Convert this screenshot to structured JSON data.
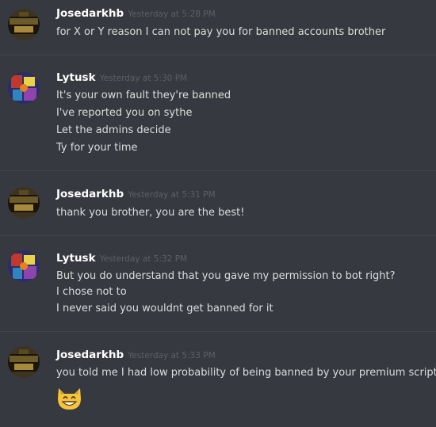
{
  "messages": [
    {
      "author": "Josedarkhb",
      "timestamp": "Yesterday at 5:28 PM",
      "avatar": "josedarkhb-avatar",
      "lines": [
        "for X or Y reason I can not pay you for banned accounts brother"
      ]
    },
    {
      "author": "Lytusk",
      "timestamp": "Yesterday at 5:30 PM",
      "avatar": "lytusk-avatar",
      "lines": [
        "It's your own fault they're banned",
        "I've reported you on sythe",
        "Let the admins decide",
        "Ty for your time"
      ]
    },
    {
      "author": "Josedarkhb",
      "timestamp": "Yesterday at 5:31 PM",
      "avatar": "josedarkhb-avatar",
      "lines": [
        "thank you brother, you are the best!"
      ]
    },
    {
      "author": "Lytusk",
      "timestamp": "Yesterday at 5:32 PM",
      "avatar": "lytusk-avatar",
      "lines": [
        "But you do understand that you gave my permission to bot right?",
        "I chose not to",
        "I never said you wouldnt get banned for it"
      ]
    },
    {
      "author": "Josedarkhb",
      "timestamp": "Yesterday at 5:33 PM",
      "avatar": "josedarkhb-avatar",
      "lines": [
        "you told me I had low probability of being banned by your premium scripts"
      ],
      "emoji": "smiling-cat-face-with-heart-eyes-icon"
    }
  ],
  "colors": {
    "background": "#36393f",
    "author": "#ffffff",
    "timestamp": "#5c6167",
    "text": "#dcddde",
    "divider": "#42454a"
  }
}
